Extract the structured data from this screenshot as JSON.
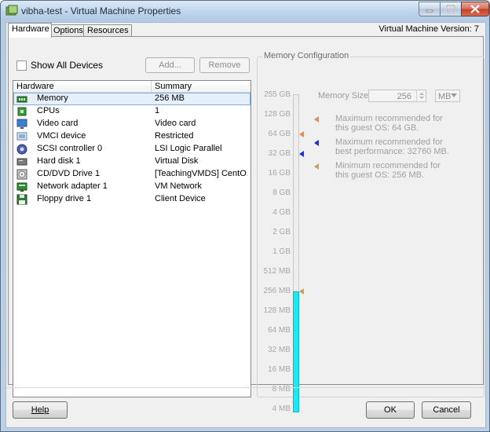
{
  "window": {
    "title": "vibha-test - Virtual Machine Properties"
  },
  "tabs": [
    {
      "label": "Hardware",
      "active": true
    },
    {
      "label": "Options",
      "active": false
    },
    {
      "label": "Resources",
      "active": false
    }
  ],
  "vm_version": "Virtual Machine Version: 7",
  "hardware": {
    "show_all_devices_label": "Show All Devices",
    "show_all_devices_checked": false,
    "add_label": "Add...",
    "remove_label": "Remove",
    "columns": [
      "Hardware",
      "Summary"
    ],
    "rows": [
      {
        "name": "Memory",
        "summary": "256 MB",
        "icon": "memory-icon",
        "selected": true
      },
      {
        "name": "CPUs",
        "summary": "1",
        "icon": "cpu-icon",
        "selected": false
      },
      {
        "name": "Video card",
        "summary": "Video card",
        "icon": "monitor-icon",
        "selected": false
      },
      {
        "name": "VMCI device",
        "summary": "Restricted",
        "icon": "vmci-icon",
        "selected": false
      },
      {
        "name": "SCSI controller 0",
        "summary": "LSI Logic Parallel",
        "icon": "scsi-icon",
        "selected": false
      },
      {
        "name": "Hard disk 1",
        "summary": "Virtual Disk",
        "icon": "hard-disk-icon",
        "selected": false
      },
      {
        "name": "CD/DVD Drive 1",
        "summary": "[TeachingVMDS] CentO...",
        "icon": "cd-dvd-icon",
        "selected": false
      },
      {
        "name": "Network adapter 1",
        "summary": "VM Network",
        "icon": "network-icon",
        "selected": false
      },
      {
        "name": "Floppy drive 1",
        "summary": "Client Device",
        "icon": "floppy-icon",
        "selected": false
      }
    ]
  },
  "memory": {
    "group_title": "Memory Configuration",
    "size_label": "Memory Size:",
    "size_value": "256",
    "unit": "MB",
    "scale_labels": [
      "255 GB",
      "128 GB",
      "64 GB",
      "32 GB",
      "16 GB",
      "8 GB",
      "4 GB",
      "2 GB",
      "1 GB",
      "512 MB",
      "256 MB",
      "128 MB",
      "64 MB",
      "32 MB",
      "16 MB",
      "8 MB",
      "4 MB"
    ],
    "current_mb": 256,
    "legend": [
      {
        "text": "Maximum recommended for this guest OS: 64 GB.",
        "color": "#d9905e",
        "at_index": 2
      },
      {
        "text": "Maximum recommended for best performance: 32760 MB.",
        "color": "#1f2fd6",
        "at_index": 3
      },
      {
        "text": "Minimum recommended for this guest OS: 256 MB.",
        "color": "#c8a060",
        "at_index": 10
      }
    ]
  },
  "footer": {
    "help_label": "Help",
    "ok_label": "OK",
    "cancel_label": "Cancel"
  }
}
